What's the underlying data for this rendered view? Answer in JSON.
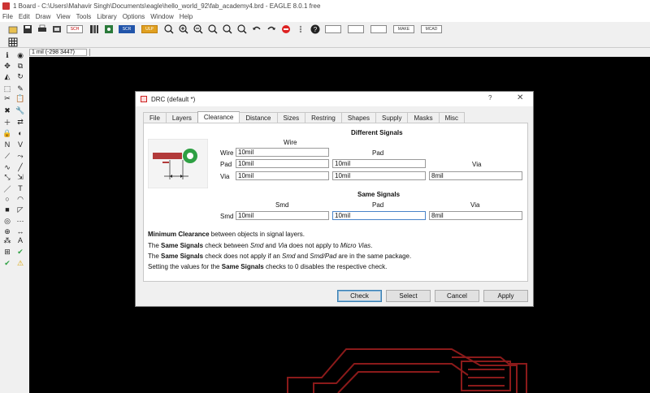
{
  "window": {
    "title": "1 Board - C:\\Users\\Mahavir Singh\\Documents\\eagle\\hello_world_92\\fab_academy4.brd - EAGLE 8.0.1 free"
  },
  "menu": [
    "File",
    "Edit",
    "Draw",
    "View",
    "Tools",
    "Library",
    "Options",
    "Window",
    "Help"
  ],
  "toolbar": {
    "buttons": [
      "open-icon",
      "save-icon",
      "print-icon",
      "cam-icon",
      "sch-icon",
      "lbr-icon",
      "scr-icon",
      "ulp-icon",
      "zoom-fit-icon",
      "zoom-in-icon",
      "zoom-out-icon",
      "zoom-select-icon",
      "redraw-icon",
      "undo-icon",
      "redo-icon",
      "stop-icon",
      "go-icon",
      "help-icon"
    ],
    "labeled": [
      "SCH",
      "SCR",
      "ULP",
      "MAKE",
      "MCAD"
    ]
  },
  "status": {
    "coordinate": "1 mil (-298 3447)"
  },
  "dialog": {
    "title": "DRC (default *)",
    "help": "?",
    "close": "✕",
    "tabs": [
      "File",
      "Layers",
      "Clearance",
      "Distance",
      "Sizes",
      "Restring",
      "Shapes",
      "Supply",
      "Masks",
      "Misc"
    ],
    "active_tab": "Clearance",
    "different_signals": {
      "heading": "Different Signals",
      "col_wire": "Wire",
      "col_pad": "Pad",
      "col_via": "Via",
      "rows": [
        {
          "label": "Wire",
          "values": [
            "10mil"
          ]
        },
        {
          "label": "Pad",
          "values": [
            "10mil",
            "10mil"
          ]
        },
        {
          "label": "Via",
          "values": [
            "10mil",
            "10mil",
            "8mil"
          ]
        }
      ]
    },
    "same_signals": {
      "heading": "Same Signals",
      "col_smd": "Smd",
      "col_pad": "Pad",
      "col_via": "Via",
      "row_label": "Smd",
      "values": [
        "10mil",
        "10mil",
        "8mil"
      ]
    },
    "help_text": {
      "line1_bold": "Minimum Clearance",
      "line1_rest": " between objects in signal layers.",
      "line2_pre": "The ",
      "line2_bold": "Same Signals",
      "line2_mid": " check between ",
      "line2_i1": "Smd",
      "line2_and": " and ",
      "line2_i2": "Via",
      "line2_post": " does not apply to ",
      "line2_i3": "Micro Vias",
      "line2_end": ".",
      "line3_pre": "The ",
      "line3_bold": "Same Signals",
      "line3_mid": " check does not apply if an ",
      "line3_i1": "Smd",
      "line3_and": " and ",
      "line3_i2": "Smd/Pad",
      "line3_end": " are in the same package.",
      "line4_pre": "Setting the values for the ",
      "line4_bold": "Same Signals",
      "line4_end": " checks to 0 disables the respective check."
    },
    "buttons": {
      "check": "Check",
      "select": "Select",
      "cancel": "Cancel",
      "apply": "Apply"
    }
  },
  "sidebar": {
    "tools": [
      "info-icon",
      "show-icon",
      "move-icon",
      "copy-icon",
      "mirror-icon",
      "rotate-icon",
      "group-icon",
      "change-icon",
      "cut-icon",
      "paste-icon",
      "delete-icon",
      "wrench-icon",
      "add-icon",
      "replace-icon",
      "lock-icon",
      "smash-icon",
      "name-icon",
      "value-icon",
      "split-icon",
      "optimize-icon",
      "meander-icon",
      "route-icon",
      "ripup-icon",
      "autoroute-icon",
      "wire-icon",
      "text-icon",
      "circle-icon",
      "arc-icon",
      "rect-icon",
      "polygon-icon",
      "via-icon",
      "signal-icon",
      "hole-icon",
      "dimension-icon",
      "attribute-icon",
      "mark-icon",
      "ratsnest-icon",
      "erc-icon",
      "drc-icon",
      "errors-icon"
    ]
  },
  "colors": {
    "trace": "#8b1a1a",
    "pad_green": "#2ea043",
    "wire_red": "#b23a3a"
  }
}
